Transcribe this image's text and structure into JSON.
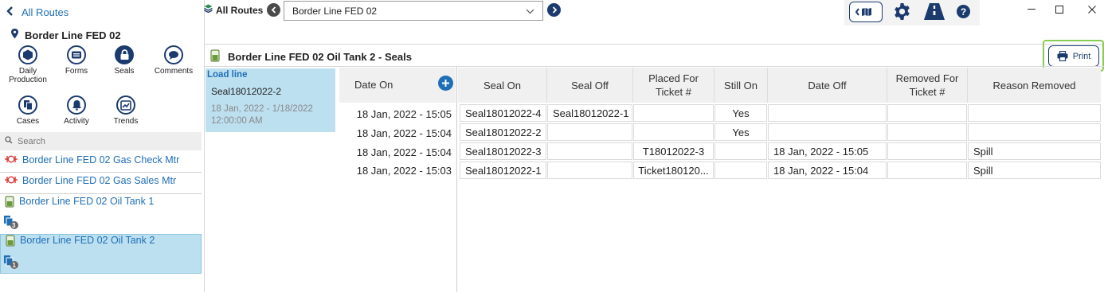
{
  "nav": {
    "back_label": "All Routes",
    "route_name": "Border Line FED 02",
    "all_routes_label": "All Routes",
    "dropdown_value": "Border Line FED 02"
  },
  "tiles": [
    {
      "label": "Daily Production",
      "icon": "hexagon-icon"
    },
    {
      "label": "Forms",
      "icon": "form-icon"
    },
    {
      "label": "Seals",
      "icon": "lock-icon"
    },
    {
      "label": "Comments",
      "icon": "comment-icon"
    },
    {
      "label": "Cases",
      "icon": "cases-icon"
    },
    {
      "label": "Activity",
      "icon": "bell-icon"
    },
    {
      "label": "Trends",
      "icon": "trend-icon"
    }
  ],
  "search": {
    "placeholder": "Search"
  },
  "assets": [
    {
      "label": "Border Line FED 02 Gas Check Mtr",
      "icon": "meter-icon"
    },
    {
      "label": "Border Line FED 02 Gas Sales Mtr",
      "icon": "meter-icon"
    },
    {
      "label": "Border Line FED 02 Oil Tank 1",
      "icon": "tank-icon",
      "badge": "3"
    },
    {
      "label": "Border Line FED 02 Oil Tank 2",
      "icon": "tank-icon",
      "badge": "1"
    }
  ],
  "main": {
    "title": "Border Line FED 02 Oil Tank 2 - Seals",
    "print_label": "Print"
  },
  "load_line": {
    "heading": "Load line",
    "seal": "Seal18012022-2",
    "date_range": "18 Jan, 2022 - 1/18/2022 12:00:00 AM"
  },
  "date_table": {
    "header": "Date On",
    "rows": [
      "18 Jan, 2022 - 15:05",
      "18 Jan, 2022 - 15:04",
      "18 Jan, 2022 - 15:04",
      "18 Jan, 2022 - 15:03"
    ]
  },
  "seal_table": {
    "headers": [
      "Seal On",
      "Seal Off",
      "Placed For Ticket #",
      "Still On",
      "Date Off",
      "Removed For Ticket #",
      "Reason Removed"
    ],
    "rows": [
      [
        "Seal18012022-4",
        "Seal18012022-1",
        "",
        "Yes",
        "",
        "",
        ""
      ],
      [
        "Seal18012022-2",
        "",
        "",
        "Yes",
        "",
        "",
        ""
      ],
      [
        "Seal18012022-3",
        "",
        "T18012022-3",
        "",
        "18 Jan, 2022 - 15:05",
        "",
        "Spill"
      ],
      [
        "Seal18012022-1",
        "",
        "Ticket180120...",
        "",
        "18 Jan, 2022 - 15:04",
        "",
        "Spill"
      ]
    ]
  },
  "colors": {
    "accent": "#1b3b6e",
    "link": "#1f6fb6",
    "selection": "#bde0f0",
    "highlight": "#88cc55"
  }
}
